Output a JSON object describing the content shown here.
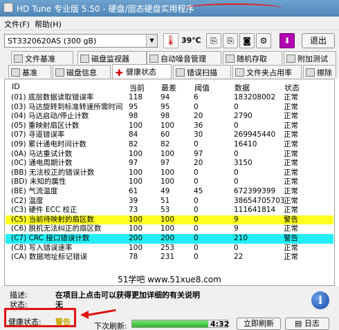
{
  "window": {
    "title": "HD Tune 专业版 5.50 - 硬盘/固态硬盘实用程序"
  },
  "menu": {
    "file": "文件(F)",
    "help": "帮助(H)"
  },
  "toolbar": {
    "drive": "ST3320620AS (300 gB)",
    "temperature": "39℃",
    "exit_label": "退出",
    "icons": [
      "copy-icon",
      "copy-icon",
      "camera-icon",
      "options-icon",
      "download-icon"
    ]
  },
  "tabs_row1": [
    {
      "label": "文件基准",
      "icon": "file-benchmark-icon"
    },
    {
      "label": "磁盘监视器",
      "icon": "disk-monitor-icon"
    },
    {
      "label": "自动噪音管理",
      "icon": "speaker-icon"
    },
    {
      "label": "随机存取",
      "icon": "random-access-icon"
    },
    {
      "label": "附加测试",
      "icon": "extra-tests-icon"
    }
  ],
  "tabs_row2": [
    {
      "label": "基准",
      "icon": "benchmark-icon"
    },
    {
      "label": "磁盘信息",
      "icon": "info-icon"
    },
    {
      "label": "健康状态",
      "icon": "health-cross-icon"
    },
    {
      "label": "错误扫描",
      "icon": "magnifier-icon"
    },
    {
      "label": "文件夹占用率",
      "icon": "folder-icon"
    },
    {
      "label": "擦除",
      "icon": "erase-icon"
    }
  ],
  "table": {
    "headers": [
      "ID",
      "当前",
      "最差",
      "阈值",
      "数据",
      "状态"
    ],
    "rows": [
      [
        "(01) 底层数据读取错误率",
        "118",
        "94",
        "6",
        "183208002",
        "正常"
      ],
      [
        "(03) 马达旋转到标准转速所需时间",
        "95",
        "95",
        "0",
        "0",
        "正常"
      ],
      [
        "(04) 马达启动/停止计数",
        "98",
        "98",
        "20",
        "2790",
        "正常"
      ],
      [
        "(05) 重映射扇区计数",
        "100",
        "100",
        "36",
        "0",
        "正常"
      ],
      [
        "(07) 寻道错误率",
        "84",
        "60",
        "30",
        "269945440",
        "正常"
      ],
      [
        "(09) 累计通电时间计数",
        "82",
        "82",
        "0",
        "16410",
        "正常"
      ],
      [
        "(0A) 马达重试计数",
        "100",
        "100",
        "97",
        "0",
        "正常"
      ],
      [
        "(0C) 通电周期计数",
        "97",
        "97",
        "20",
        "3150",
        "正常"
      ],
      [
        "(BB) 无法校正的错误计数",
        "100",
        "100",
        "0",
        "0",
        "正常"
      ],
      [
        "(BD) 未知的属性",
        "100",
        "100",
        "0",
        "0",
        "正常"
      ],
      [
        "(BE) 气流温度",
        "61",
        "49",
        "45",
        "672399399",
        "正常"
      ],
      [
        "(C2) 温度",
        "39",
        "51",
        "0",
        "38654705703",
        "正常"
      ],
      [
        "(C3) 硬件 ECC 校正",
        "73",
        "53",
        "0",
        "111641814",
        "正常"
      ],
      [
        "(C5) 当前待映射的扇区数",
        "100",
        "100",
        "0",
        "9",
        "警告"
      ],
      [
        "(C6) 脱机无法纠正的扇区数",
        "100",
        "100",
        "0",
        "9",
        "正常"
      ],
      [
        "(C7) CRC 接口错误计数",
        "200",
        "200",
        "0",
        "210",
        "警告"
      ],
      [
        "(C8) 写入错误速率",
        "100",
        "253",
        "0",
        "0",
        "正常"
      ],
      [
        "(CA) 数据地址标记错误",
        "78",
        "231",
        "0",
        "22",
        "正常"
      ]
    ],
    "highlight_colors": {
      "yellow": "#ffff22",
      "cyan": "#22eef4"
    }
  },
  "watermark": "51学吧 www.51xue8.com",
  "bottom": {
    "desc_label": "描述:",
    "desc_text": "在项目上点击可以获得更加详细的有关说明",
    "status_label": "状态:",
    "status_text": "无",
    "health_label": "健康状态:",
    "health_value": "警告",
    "next_refresh_label": "下次刷新:",
    "progress_fraction": 0.8,
    "countdown": "4:32",
    "refresh_now_label": "立即刷新",
    "log_label": "日志"
  }
}
